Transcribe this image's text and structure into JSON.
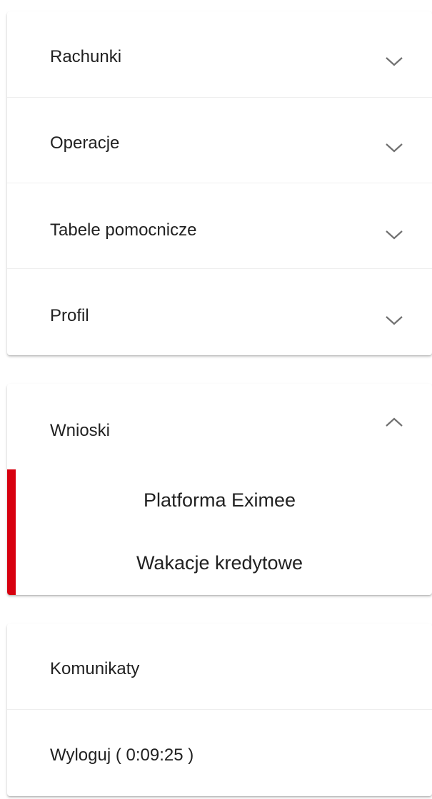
{
  "menu": {
    "items": [
      {
        "label": "Rachunki",
        "icon": "chevron-down-icon"
      },
      {
        "label": "Operacje",
        "icon": "chevron-down-icon"
      },
      {
        "label": "Tabele pomocnicze",
        "icon": "chevron-down-icon"
      },
      {
        "label": "Profil",
        "icon": "chevron-down-icon"
      }
    ],
    "expanded": {
      "label": "Wnioski",
      "icon": "chevron-up-icon",
      "subitems": [
        {
          "label": "Platforma Eximee"
        },
        {
          "label": "Wakacje kredytowe"
        }
      ]
    },
    "bottom": [
      {
        "label": "Komunikaty"
      },
      {
        "label": "Wyloguj ( 0:09:25 )"
      }
    ]
  },
  "colors": {
    "accent": "#d7000f",
    "text": "#212121",
    "chevron": "#707070"
  }
}
